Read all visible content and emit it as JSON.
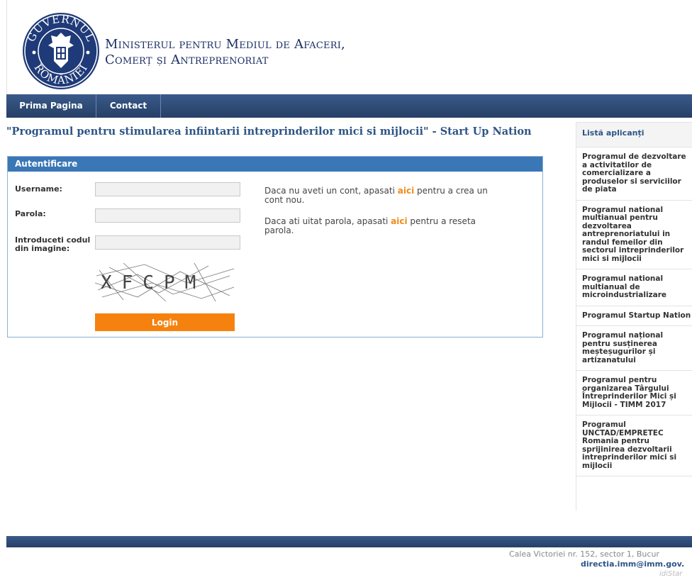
{
  "header": {
    "logo_text_top": "GUVERNUL",
    "logo_text_bottom": "ROMÂNIEI",
    "ministry_line1": "Ministerul pentru Mediul de Afaceri,",
    "ministry_line2": "Comerț și Antreprenoriat"
  },
  "nav": {
    "items": [
      {
        "label": "Prima Pagina"
      },
      {
        "label": "Contact"
      }
    ]
  },
  "page_title": "\"Programul pentru stimularea infiintarii intreprinderilor mici si mijlocii\" - Start Up Nation",
  "login": {
    "panel_title": "Autentificare",
    "username_label": "Username:",
    "username_value": "",
    "password_label": "Parola:",
    "password_value": "",
    "captcha_label": "Introduceti codul din imagine:",
    "captcha_value": "",
    "captcha_text": "XFCPM",
    "login_button": "Login",
    "info1_before": "Daca nu aveti un cont, apasati ",
    "info1_link": "aici",
    "info1_after": " pentru a crea un cont nou.",
    "info2_before": "Daca ati uitat parola, apasati ",
    "info2_link": "aici",
    "info2_after": " pentru a reseta parola."
  },
  "sidebar": {
    "title": "Listă aplicanți",
    "items": [
      {
        "label": "Programul de dezvoltare\na activitatilor de\ncomercializare a\nproduselor si serviciilor\nde piata"
      },
      {
        "label": "Programul national\nmultianual pentru\ndezvoltarea\nantreprenoriatului in\nrandul femeilor din\nsectorul intreprinderilor\nmici si mijlocii"
      },
      {
        "label": "Programul national\nmultianual de\nmicroindustrializare"
      },
      {
        "label": "Programul Startup Nation"
      },
      {
        "label": "Programul național\npentru susținerea\nmeșteșugurilor și\nartizanatului"
      },
      {
        "label": "Programul pentru\norganizarea Târgului\nÎntreprinderilor Mici și\nMijlocii - TIMM 2017"
      },
      {
        "label": "Programul\nUNCTAD/EMPRETEC\nRomania pentru\nsprijinirea dezvoltarii\nintreprinderilor mici si\nmijlocii"
      }
    ]
  },
  "footer": {
    "address": "Calea Victoriei nr. 152, sector 1, Bucur",
    "email": "directia.imm@imm.gov.",
    "watermark": "idiStar"
  },
  "colors": {
    "nav_bg": "#2d4a75",
    "panel_head": "#3a77b6",
    "login_button": "#f5820e",
    "link": "#f28a17",
    "title": "#2d5587"
  }
}
